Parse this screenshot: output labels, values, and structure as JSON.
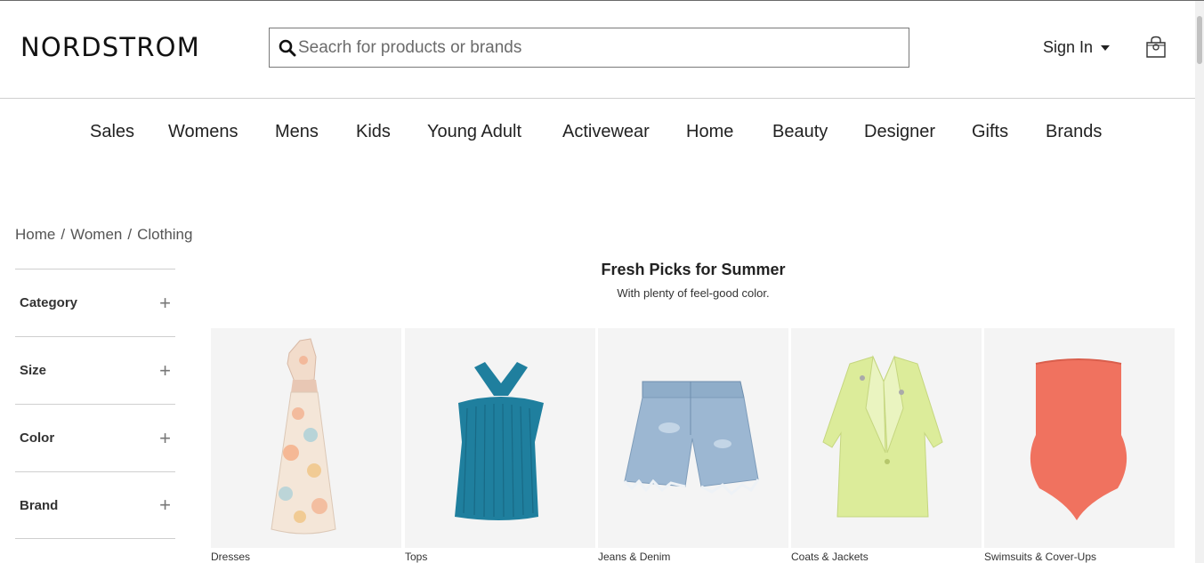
{
  "brand": {
    "logo_text": "NORDSTROM"
  },
  "search": {
    "placeholder": "Seacrh for products or brands"
  },
  "account": {
    "sign_in_label": "Sign In"
  },
  "icons": {
    "search": "search-icon",
    "bag": "shopping-bag-icon",
    "caret": "caret-down-icon",
    "expand": "plus-icon"
  },
  "nav": {
    "items": [
      "Sales",
      "Womens",
      "Mens",
      "Kids",
      "Young Adult",
      "Activewear",
      "Home",
      "Beauty",
      "Designer",
      "Gifts",
      "Brands"
    ]
  },
  "breadcrumb": {
    "items": [
      "Home",
      "Women",
      "Clothing"
    ],
    "separator": "/"
  },
  "filters": {
    "items": [
      {
        "label": "Category",
        "expand_symbol": "+"
      },
      {
        "label": "Size",
        "expand_symbol": "+"
      },
      {
        "label": "Color",
        "expand_symbol": "+"
      },
      {
        "label": "Brand",
        "expand_symbol": "+"
      }
    ]
  },
  "promo": {
    "title": "Fresh Picks for Summer",
    "subtitle": "With plenty of feel-good color.",
    "tiles": [
      {
        "caption": "Dresses",
        "image": "floral-dress-image"
      },
      {
        "caption": "Tops",
        "image": "teal-halter-top-image"
      },
      {
        "caption": "Jeans & Denim",
        "image": "denim-shorts-image"
      },
      {
        "caption": "Coats & Jackets",
        "image": "lime-blazer-image"
      },
      {
        "caption": "Swimsuits & Cover-Ups",
        "image": "coral-swimsuit-image"
      }
    ]
  },
  "colors": {
    "tile_background": "#f4f4f4",
    "text": "#222222",
    "divider": "#cfcfcf",
    "swimsuit": "#f0725f",
    "top": "#1f7f9e",
    "blazer": "#dcec9a",
    "denim": "#9cb7d2"
  }
}
